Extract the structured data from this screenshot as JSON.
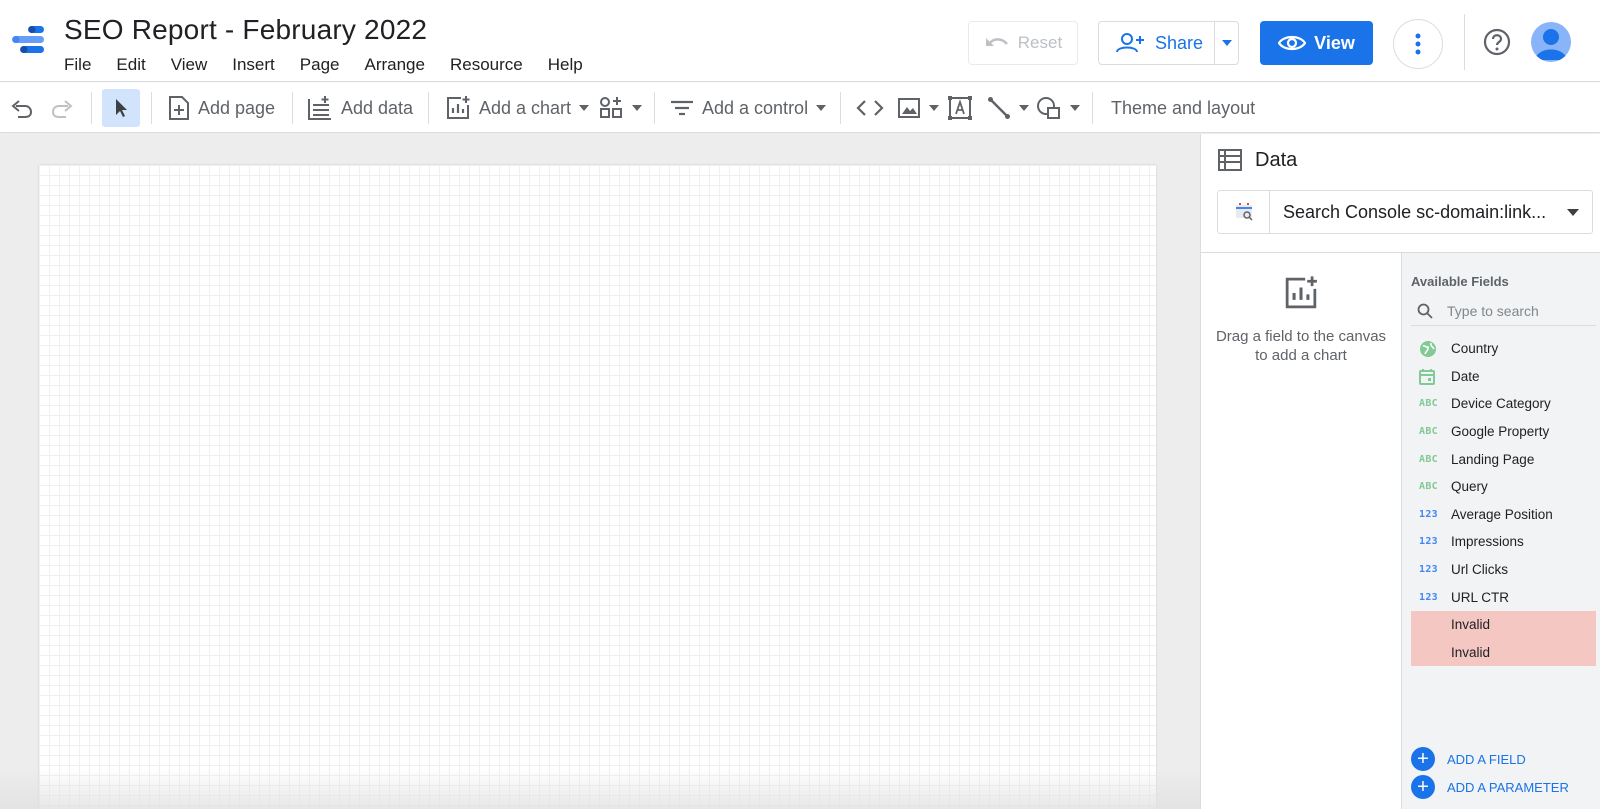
{
  "app": {
    "title": "SEO Report - February 2022",
    "menu": [
      "File",
      "Edit",
      "View",
      "Insert",
      "Page",
      "Arrange",
      "Resource",
      "Help"
    ]
  },
  "header_actions": {
    "reset_label": "Reset",
    "share_label": "Share",
    "view_label": "View"
  },
  "toolbar": {
    "add_page": "Add page",
    "add_data": "Add data",
    "add_chart": "Add a chart",
    "add_control": "Add a control",
    "theme_layout": "Theme and layout"
  },
  "data_panel": {
    "title": "Data",
    "data_source": "Search Console sc-domain:link...",
    "drag_hint": "Drag a field to the canvas to add a chart",
    "available_fields_title": "Available Fields",
    "search_placeholder": "Type to search",
    "fields": [
      {
        "name": "Country",
        "type": "geo"
      },
      {
        "name": "Date",
        "type": "date"
      },
      {
        "name": "Device Category",
        "type": "text"
      },
      {
        "name": "Google Property",
        "type": "text"
      },
      {
        "name": "Landing Page",
        "type": "text"
      },
      {
        "name": "Query",
        "type": "text"
      },
      {
        "name": "Average Position",
        "type": "number"
      },
      {
        "name": "Impressions",
        "type": "number"
      },
      {
        "name": "Url Clicks",
        "type": "number"
      },
      {
        "name": "URL CTR",
        "type": "number"
      },
      {
        "name": "Invalid",
        "type": "invalid"
      },
      {
        "name": "Invalid",
        "type": "invalid"
      }
    ],
    "type_badges": {
      "text": "ABC",
      "number": "123"
    },
    "add_field": "ADD A FIELD",
    "add_parameter": "ADD A PARAMETER"
  },
  "colors": {
    "accent": "#1a73e8",
    "dimension_green": "#81c995",
    "metric_blue": "#4285f4",
    "invalid_bg": "#f4c7c3"
  }
}
